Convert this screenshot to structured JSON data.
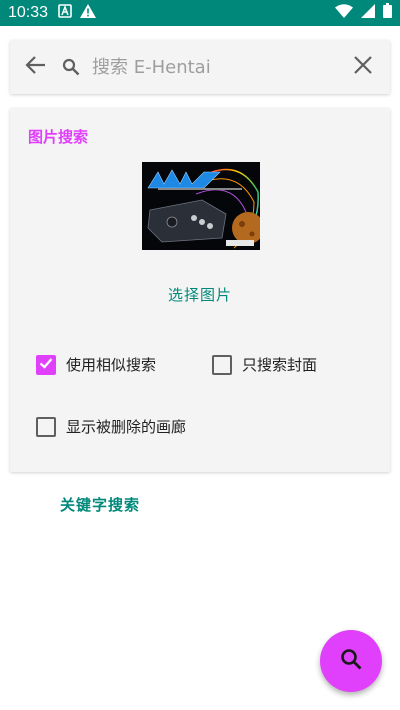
{
  "status_bar": {
    "time": "10:33",
    "icons": [
      "notification-a-icon",
      "warning-icon",
      "wifi-icon",
      "signal-icon",
      "battery-icon"
    ]
  },
  "search": {
    "placeholder": "搜索 E-Hentai",
    "value": ""
  },
  "image_search": {
    "title": "图片搜索",
    "choose_label": "选择图片",
    "thumbnail_text": "MAME",
    "options": [
      {
        "label": "使用相似搜索",
        "checked": true
      },
      {
        "label": "只搜索封面",
        "checked": false
      },
      {
        "label": "显示被删除的画廊",
        "checked": false
      }
    ]
  },
  "keyword_search_label": "关键字搜索",
  "colors": {
    "status_bar": "#00897b",
    "accent": "#e040fb",
    "teal_text": "#00897b",
    "card_bg": "#f4f4f4"
  }
}
